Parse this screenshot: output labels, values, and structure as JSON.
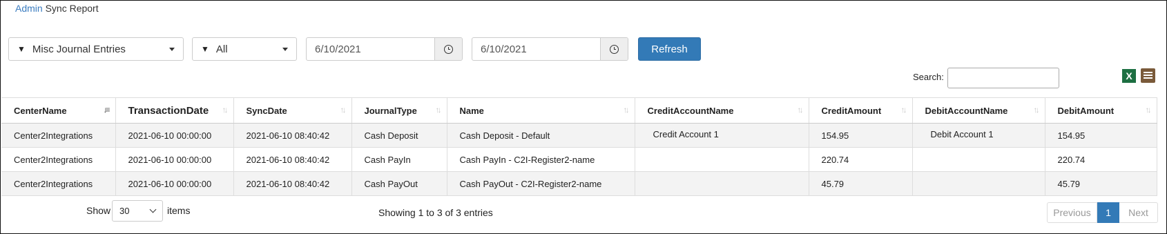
{
  "breadcrumb": {
    "link": "Admin",
    "current": "Sync Report"
  },
  "filters": {
    "entry_type": "Misc Journal Entries",
    "scope": "All",
    "start_date": "6/10/2021",
    "end_date": "6/10/2021",
    "refresh_label": "Refresh"
  },
  "search": {
    "label": "Search:",
    "value": ""
  },
  "icons": {
    "excel": "excel-export-icon",
    "csv": "csv-export-icon",
    "filter": "filter-icon",
    "clock": "clock-icon"
  },
  "table": {
    "headers": [
      "CenterName",
      "TransactionDate",
      "SyncDate",
      "JournalType",
      "Name",
      "CreditAccountName",
      "CreditAmount",
      "DebitAccountName",
      "DebitAmount"
    ],
    "rows": [
      [
        "Center2Integrations",
        "2021-06-10 00:00:00",
        "2021-06-10 08:40:42",
        "Cash Deposit",
        "Cash Deposit - Default",
        "Credit Account 1",
        "154.95",
        "Debit Account 1",
        "154.95"
      ],
      [
        "Center2Integrations",
        "2021-06-10 00:00:00",
        "2021-06-10 08:40:42",
        "Cash PayIn",
        "Cash PayIn - C2I-Register2-name",
        "",
        "220.74",
        "",
        "220.74"
      ],
      [
        "Center2Integrations",
        "2021-06-10 00:00:00",
        "2021-06-10 08:40:42",
        "Cash PayOut",
        "Cash PayOut - C2I-Register2-name",
        "",
        "45.79",
        "",
        "45.79"
      ]
    ]
  },
  "footer": {
    "show_label": "Show",
    "page_size": "30",
    "items_label": "items",
    "summary": "Showing 1 to 3 of 3 entries",
    "prev_label": "Previous",
    "current_page": "1",
    "next_label": "Next"
  },
  "colors": {
    "accent": "#337ab7",
    "link": "#3a7cc0",
    "excel": "#1d6f42"
  }
}
